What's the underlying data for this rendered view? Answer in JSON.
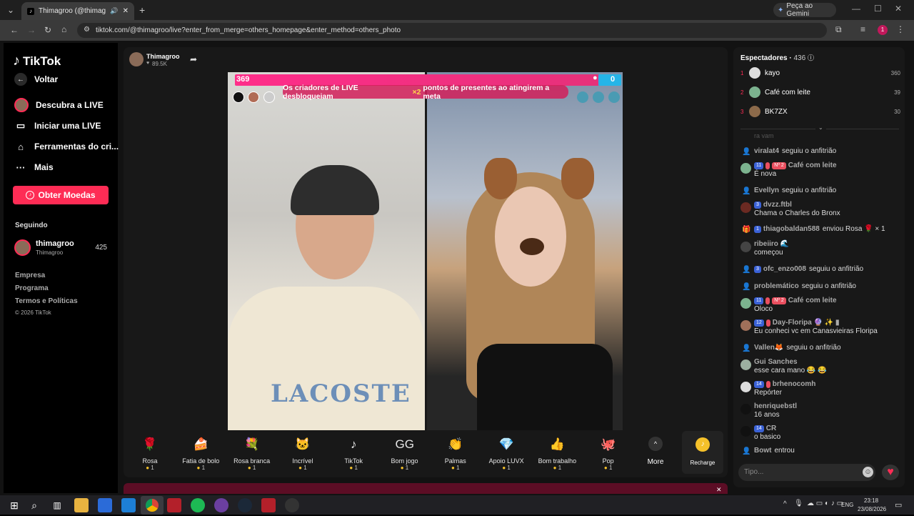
{
  "browser": {
    "tab_title": "Thimagroo (@thimagroo) o",
    "new_tab": "+",
    "gemini": "Peça ao Gemini",
    "url": "tiktok.com/@thimagroo/live?enter_from_merge=others_homepage&enter_method=others_photo",
    "profile_initial": "1"
  },
  "sidebar": {
    "logo": "TikTok",
    "back": "Voltar",
    "items": [
      "Descubra a LIVE",
      "Iniciar uma LIVE",
      "Ferramentas do cri...",
      "Mais"
    ],
    "coins_button": "Obter Moedas",
    "following_title": "Seguindo",
    "following": {
      "name": "thimagroo",
      "handle": "Thimagroo",
      "count": "425"
    },
    "footer": [
      "Empresa",
      "Programa",
      "Termos e Políticas",
      "© 2026 TikTok"
    ]
  },
  "host": {
    "name": "Thimagroo",
    "likes": "89.5K"
  },
  "pk": {
    "left_score": "369",
    "right_score": "0",
    "banner_prefix": "Os criadores de LIVE desbloqueiam",
    "banner_mult": "×2",
    "banner_suffix": "pontos de presentes ao atingirem a meta"
  },
  "video": {
    "shirt_brand": "LACOSTE"
  },
  "gifts": [
    {
      "name": "Rosa",
      "price": "1",
      "icon": "🌹"
    },
    {
      "name": "Fatia de bolo",
      "price": "1",
      "icon": "🍰"
    },
    {
      "name": "Rosa branca",
      "price": "1",
      "icon": "💐"
    },
    {
      "name": "Incrível",
      "price": "1",
      "icon": "🐱"
    },
    {
      "name": "TikTok",
      "price": "1",
      "icon": "♪"
    },
    {
      "name": "Bom jogo",
      "price": "1",
      "icon": "GG"
    },
    {
      "name": "Palmas",
      "price": "1",
      "icon": "👏"
    },
    {
      "name": "Apoio LUVX",
      "price": "1",
      "icon": "💎"
    },
    {
      "name": "Bom trabalho",
      "price": "1",
      "icon": "👍"
    },
    {
      "name": "Pop",
      "price": "1",
      "icon": "🐙"
    }
  ],
  "gift_more": "More",
  "recharge": "Recharge",
  "viewers": {
    "title": "Espectadores",
    "count": "436",
    "list": [
      {
        "rank": "1",
        "name": "kayo",
        "score": "360",
        "color": "#ddd"
      },
      {
        "rank": "2",
        "name": "Café com leite",
        "score": "39",
        "color": "#7cb38f"
      },
      {
        "rank": "3",
        "name": "BK7ZX",
        "score": "30",
        "color": "#8c6a4a"
      }
    ],
    "faded": "ra vam"
  },
  "comments": [
    {
      "name": "viralat4",
      "text": "seguiu o anfitrião",
      "type": "event"
    },
    {
      "name": "Café com leite",
      "badges": [
        "11",
        "",
        "Nº 2"
      ],
      "text": "É nova",
      "type": "msg"
    },
    {
      "name": "Evellyn",
      "text": "seguiu o anfitrião",
      "type": "event"
    },
    {
      "name": "dvzz.ftbl",
      "badges": [
        "3"
      ],
      "text": "Chama o Charles do Bronx",
      "type": "msg"
    },
    {
      "name": "thiagobaldan588",
      "badges": [
        "1"
      ],
      "text": "enviou Rosa 🌹 × 1",
      "type": "gift"
    },
    {
      "name": "ribeiiro 🌊",
      "text": "começou",
      "type": "msg"
    },
    {
      "name": "ofc_enzo008",
      "badges": [
        "3"
      ],
      "text": "seguiu o anfitrião",
      "type": "event"
    },
    {
      "name": "problemático",
      "text": "seguiu o anfitrião",
      "type": "event"
    },
    {
      "name": "Café com leite",
      "badges": [
        "11",
        "",
        "Nº 2"
      ],
      "text": "Oloco",
      "type": "msg"
    },
    {
      "name": "Day-Floripa 🔮 ✨ ▮",
      "badges": [
        "12",
        ""
      ],
      "text": "Eu conheci vc em Canasvieiras Floripa",
      "type": "msg"
    },
    {
      "name": "Vallen🦊",
      "text": "seguiu o anfitrião",
      "type": "event"
    },
    {
      "name": "Gui Sanches",
      "text": "esse cara mano 😂 😂",
      "type": "msg"
    },
    {
      "name": "brhenocomh",
      "badges": [
        "14",
        ""
      ],
      "text": "Repórter",
      "type": "msg"
    },
    {
      "name": "henriquebstl",
      "text": "16 anos",
      "type": "msg"
    },
    {
      "name": "CR",
      "badges": [
        "14"
      ],
      "text": "o basico",
      "type": "msg"
    },
    {
      "name": "Bowt",
      "text": "entrou",
      "type": "event"
    }
  ],
  "chat_placeholder": "Tipo...",
  "taskbar": {
    "lang": "ENG",
    "time": "23:18",
    "date": "23/08/2026"
  }
}
